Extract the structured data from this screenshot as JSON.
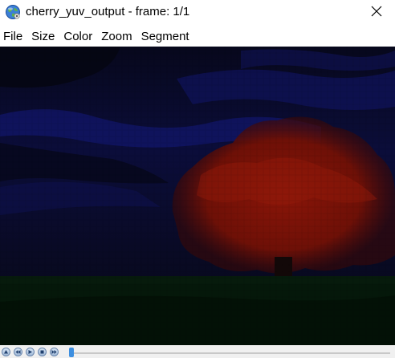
{
  "window": {
    "title": "cherry_yuv_output - frame: 1/1"
  },
  "menu": {
    "items": [
      {
        "label": "File"
      },
      {
        "label": "Size"
      },
      {
        "label": "Color"
      },
      {
        "label": "Zoom"
      },
      {
        "label": "Segment"
      }
    ]
  },
  "icons": {
    "app": "globe-app-icon",
    "close": "close-icon",
    "playback": [
      "up-arrow-icon",
      "rewind-icon",
      "play-icon",
      "stop-icon",
      "fast-forward-icon"
    ]
  },
  "playback": {
    "progress": 0.0
  },
  "colors": {
    "sky": "#0b0d3a",
    "tree": "#7a1208",
    "ground": "#05180a",
    "seek_thumb": "#3d8fe0"
  }
}
